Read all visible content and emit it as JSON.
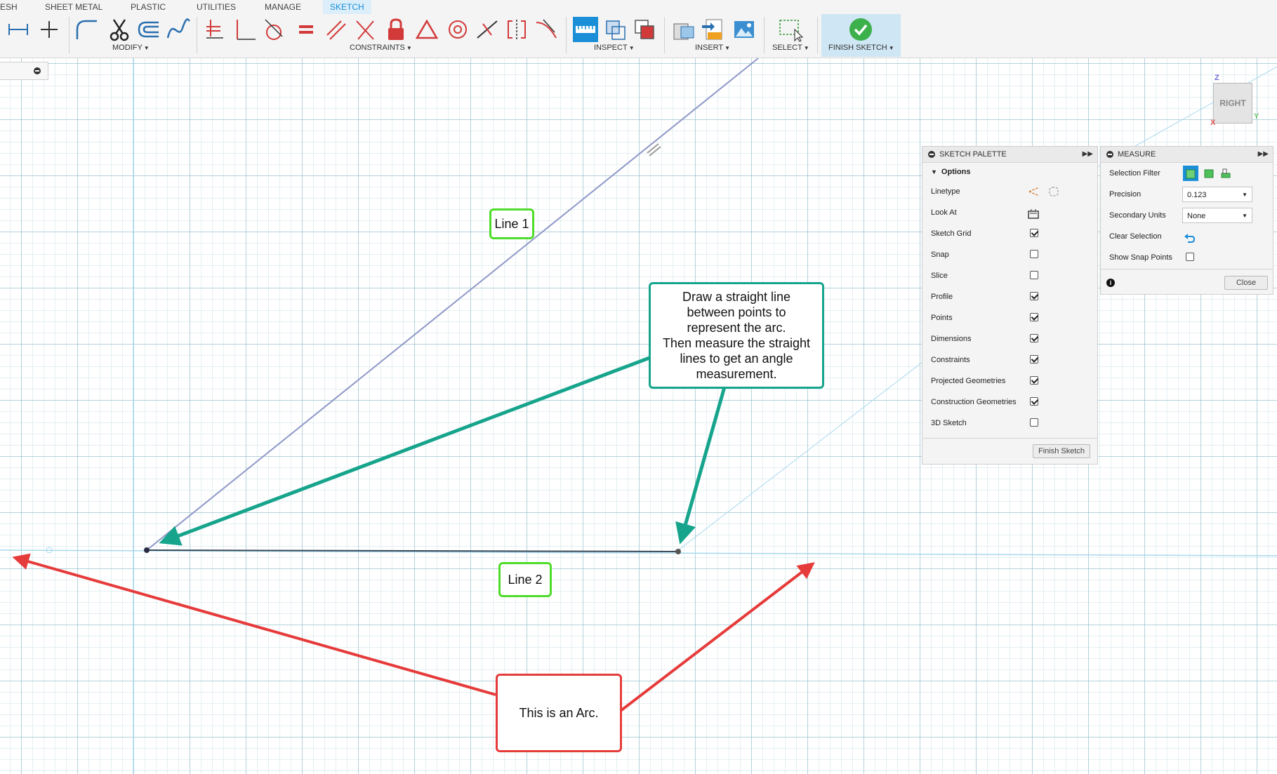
{
  "tabs": [
    "ESH",
    "SHEET METAL",
    "PLASTIC",
    "UTILITIES",
    "MANAGE",
    "SKETCH"
  ],
  "toolbar_groups": {
    "modify": "MODIFY",
    "constraints": "CONSTRAINTS",
    "inspect": "INSPECT",
    "insert": "INSERT",
    "select": "SELECT",
    "finish_sketch": "FINISH SKETCH"
  },
  "callouts": {
    "line1": "Line 1",
    "line2": "Line 2",
    "instruction": [
      "Draw a straight line",
      "between points to",
      "represent the arc.",
      "Then measure the straight",
      "lines to get an angle",
      "measurement."
    ],
    "arc": "This is an Arc."
  },
  "sketch_palette": {
    "title": "SKETCH PALETTE",
    "section": "Options",
    "rows": [
      {
        "label": "Linetype",
        "control": "icons"
      },
      {
        "label": "Look At",
        "control": "icon"
      },
      {
        "label": "Sketch Grid",
        "checked": true
      },
      {
        "label": "Snap",
        "checked": false
      },
      {
        "label": "Slice",
        "checked": false
      },
      {
        "label": "Profile",
        "checked": true
      },
      {
        "label": "Points",
        "checked": true
      },
      {
        "label": "Dimensions",
        "checked": true
      },
      {
        "label": "Constraints",
        "checked": true
      },
      {
        "label": "Projected Geometries",
        "checked": true
      },
      {
        "label": "Construction Geometries",
        "checked": true
      },
      {
        "label": "3D Sketch",
        "checked": false
      }
    ],
    "finish_button": "Finish Sketch"
  },
  "measure": {
    "title": "MEASURE",
    "selection_filter_label": "Selection Filter",
    "precision_label": "Precision",
    "precision_value": "0.123",
    "secondary_units_label": "Secondary Units",
    "secondary_units_value": "None",
    "clear_selection_label": "Clear Selection",
    "show_snap_points_label": "Show Snap Points",
    "show_snap_points_checked": false,
    "close_button": "Close"
  },
  "viewcube": {
    "face": "RIGHT",
    "axes": [
      "Z",
      "X",
      "Y"
    ]
  },
  "colors": {
    "sketch_tab": "#1a8fd8",
    "line1": "#8f98c8",
    "line2": "#3a4a58",
    "teal_arrow": "#17a48c",
    "red_arrow": "#e63b3b",
    "green_label_border": "#4fdc2a",
    "construction": "#a8d8ee"
  }
}
